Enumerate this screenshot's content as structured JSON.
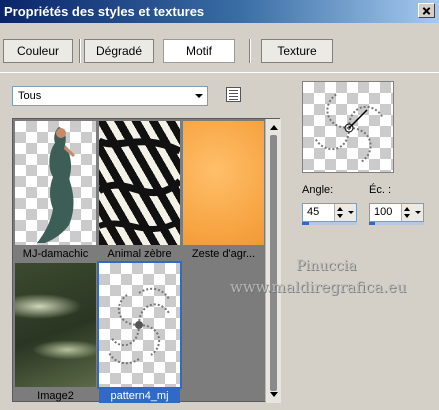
{
  "window": {
    "title": "Propriétés des styles et textures"
  },
  "tabs": [
    {
      "label": "Couleur"
    },
    {
      "label": "Dégradé"
    },
    {
      "label": "Motif"
    },
    {
      "label": "Texture"
    }
  ],
  "category": {
    "selected": "Tous"
  },
  "patterns": [
    {
      "label": "MJ-damachic"
    },
    {
      "label": "Animal zèbre"
    },
    {
      "label": "Zeste d'agr..."
    },
    {
      "label": "Image2"
    },
    {
      "label": "pattern4_mj",
      "selected": true
    }
  ],
  "angle": {
    "label": "Angle:",
    "value": "45",
    "fraction": 0.125
  },
  "scale": {
    "label": "Éc. :",
    "value": "100",
    "fraction": 0.1
  },
  "watermark": {
    "line1": "Pinuccia",
    "line2": "www.maldiregrafica.eu"
  },
  "colors": {
    "title_start": "#0a246a",
    "selection": "#3169c6",
    "panel": "#d4d0c8"
  }
}
